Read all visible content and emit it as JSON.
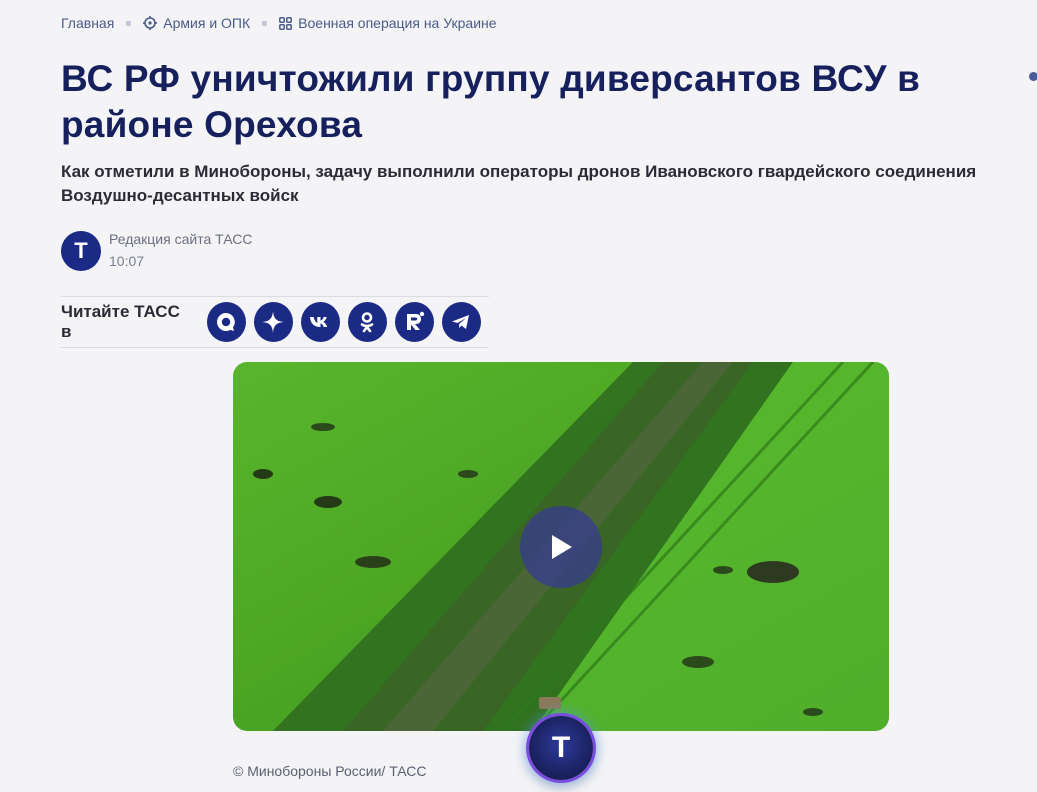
{
  "breadcrumb": {
    "home": "Главная",
    "section": "Армия и ОПК",
    "topic": "Военная операция на Украине"
  },
  "article": {
    "title": "ВС РФ уничтожили группу диверсантов ВСУ в районе Орехова",
    "lead": "Как отметили в Минобороны, задачу выполнили операторы дронов Ивановского гвардейского соединения Воздушно-десантных войск"
  },
  "author": {
    "avatar_letter": "Т",
    "name": "Редакция сайта ТАСС",
    "time": "10:07"
  },
  "social": {
    "label": "Читайте ТАСС в",
    "icons": [
      "max-icon",
      "dzen-icon",
      "vk-icon",
      "odnoklassniki-icon",
      "rutube-icon",
      "telegram-icon"
    ]
  },
  "media": {
    "caption": "© Минобороны России/ ТАСС"
  },
  "fab": {
    "letter": "Т"
  },
  "colors": {
    "brand": "#1b2a85",
    "title": "#15205c"
  }
}
